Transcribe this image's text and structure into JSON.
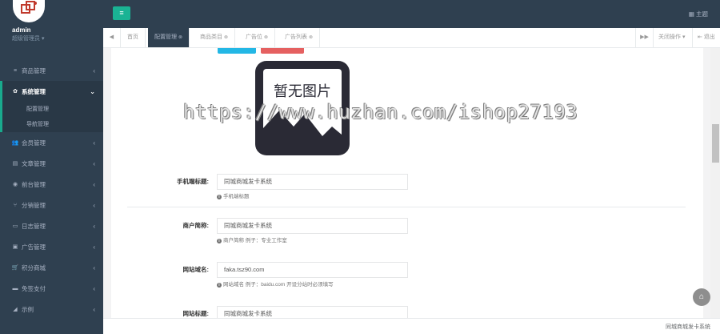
{
  "user": {
    "name": "admin",
    "role": "超级管理员 ▾"
  },
  "sidebar": {
    "items": [
      {
        "icon": "≡",
        "icon_name": "list-icon",
        "label": "商品管理",
        "arrow": "‹"
      },
      {
        "icon": "✿",
        "icon_name": "gear-icon",
        "label": "系统管理",
        "arrow": "⌄",
        "active": true
      },
      {
        "icon": "👥",
        "icon_name": "users-icon",
        "label": "会员管理",
        "arrow": "‹"
      },
      {
        "icon": "▤",
        "icon_name": "document-icon",
        "label": "文章管理",
        "arrow": "‹"
      },
      {
        "icon": "◉",
        "icon_name": "database-icon",
        "label": "前台管理",
        "arrow": "‹"
      },
      {
        "icon": "⑂",
        "icon_name": "share-icon",
        "label": "分销管理",
        "arrow": "‹"
      },
      {
        "icon": "▭",
        "icon_name": "calendar-icon",
        "label": "日志管理",
        "arrow": "‹"
      },
      {
        "icon": "▣",
        "icon_name": "image-icon",
        "label": "广告管理",
        "arrow": "‹"
      },
      {
        "icon": "🛒",
        "icon_name": "cart-icon",
        "label": "积分商城",
        "arrow": "‹"
      },
      {
        "icon": "▬",
        "icon_name": "credit-card-icon",
        "label": "免签支付",
        "arrow": "‹"
      },
      {
        "icon": "◢",
        "icon_name": "chart-icon",
        "label": "示例",
        "arrow": "‹"
      }
    ],
    "sub_items": [
      "配置管理",
      "导航管理"
    ]
  },
  "topbar": {
    "menu_icon": "≡",
    "theme_label": "▦ 主题"
  },
  "tabs": {
    "left_arrow": "◀",
    "items": [
      {
        "label": "首页",
        "close": ""
      },
      {
        "label": "配置管理",
        "close": "⊗",
        "active": true
      },
      {
        "label": "商品类目",
        "close": "⊗"
      },
      {
        "label": "广告位",
        "close": "⊗"
      },
      {
        "label": "广告列表",
        "close": "⊗"
      }
    ],
    "right_arrow": "▶▶",
    "tab_ops": "关闭操作 ▾",
    "logout": "⇤ 退出"
  },
  "noimage": {
    "text": "暂无图片"
  },
  "watermark": "https://www.huzhan.com/ishop27193",
  "form": {
    "fields": [
      {
        "label": "手机端标题:",
        "value": "同城商城发卡系统",
        "help": "手机端标题"
      },
      {
        "label": "商户简称:",
        "value": "同城商城发卡系统",
        "help": "商户简称 例子：专业工作室"
      },
      {
        "label": "网站域名:",
        "value": "faka.tsz90.com",
        "help": "网站域名 例子：baidu.com 开设分站时必须填写"
      },
      {
        "label": "网站标题:",
        "value": "同城商城发卡系统",
        "help": ""
      }
    ]
  },
  "home_icon": "⌂",
  "footer": "同城商城发卡系统",
  "colors": {
    "sidebar": "#2f4050",
    "accent": "#1ab394",
    "blue": "#23b7e5",
    "red": "#e56060"
  }
}
